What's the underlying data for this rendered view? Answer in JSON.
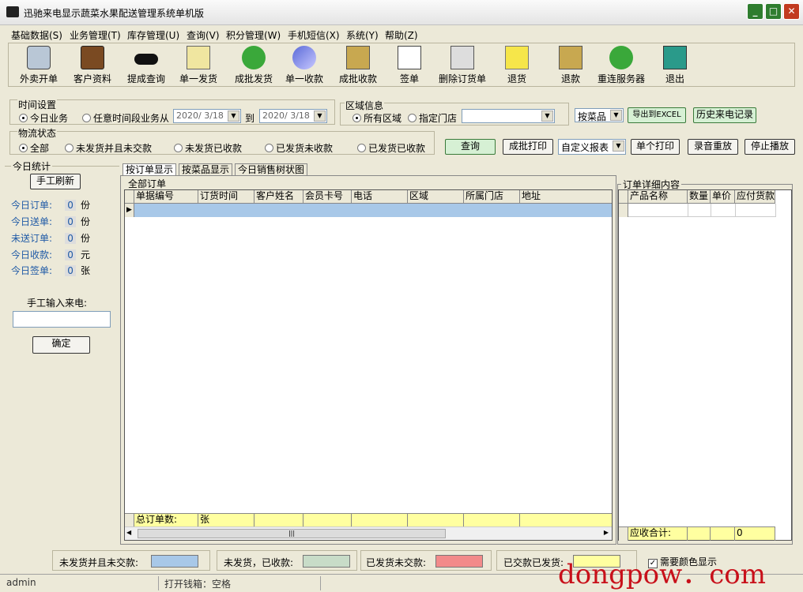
{
  "window": {
    "title": "迅驰来电显示蔬菜水果配送管理系统单机版"
  },
  "menu": [
    "基础数据(S)",
    "业务管理(T)",
    "库存管理(U)",
    "查询(V)",
    "积分管理(W)",
    "手机短信(X)",
    "系统(Y)",
    "帮助(Z)"
  ],
  "toolbar": [
    "外卖开单",
    "客户资料",
    "提成查询",
    "单一发货",
    "成批发货",
    "单一收款",
    "成批收款",
    "签单",
    "删除订货单",
    "退货",
    "退款",
    "重连服务器",
    "退出"
  ],
  "filters": {
    "time_group": "时间设置",
    "today_business": "今日业务",
    "any_period": "任意时间段业务从",
    "date_from": "2020/ 3/18",
    "to": "到",
    "date_to": "2020/ 3/18",
    "region_group": "区域信息",
    "all_regions": "所有区域",
    "specific_store": "指定门店",
    "store_value": "",
    "by_dish": "按菜品",
    "export_excel": "导出到EXCEL",
    "history_calls": "历史来电记录",
    "logistics_group": "物流状态",
    "all": "全部",
    "not_shipped_unpaid": "未发货并且未交款",
    "not_shipped_paid": "未发货已收款",
    "shipped_unpaid": "已发货未收款",
    "shipped_paid": "已发货已收款"
  },
  "actions": {
    "query": "查询",
    "batch_print": "成批打印",
    "custom_report": "自定义报表",
    "single_print": "单个打印",
    "replay": "录音重放",
    "stop_play": "停止播放"
  },
  "today_stats": {
    "title": "今日统计",
    "refresh": "手工刷新",
    "items": [
      {
        "label": "今日订单:",
        "value": "0",
        "unit": "份"
      },
      {
        "label": "今日送单:",
        "value": "0",
        "unit": "份"
      },
      {
        "label": "未送订单:",
        "value": "0",
        "unit": "份"
      },
      {
        "label": "今日收款:",
        "value": "0",
        "unit": "元"
      },
      {
        "label": "今日签单:",
        "value": "0",
        "unit": "张"
      }
    ],
    "manual_input_label": "手工输入来电:",
    "manual_input_value": "",
    "confirm": "确定"
  },
  "tabs": [
    "按订单显示",
    "按菜品显示",
    "今日销售树状图"
  ],
  "orders": {
    "title": "全部订单",
    "columns": [
      "单据编号",
      "订货时间",
      "客户姓名",
      "会员卡号",
      "电话",
      "区域",
      "所属门店",
      "地址"
    ],
    "footer_label": "总订单数:",
    "footer_unit": "张"
  },
  "details": {
    "title": "订单详细内容",
    "columns": [
      "产品名称",
      "数量",
      "单价",
      "应付货款"
    ],
    "footer_label": "应收合计:",
    "footer_value": "0"
  },
  "legend": {
    "a": "未发货并且未交款:",
    "b": "未发货，已收款:",
    "c": "已发货未交款:",
    "d": "已交款已发货:",
    "need_color": "需要颜色显示",
    "colors": {
      "a": "#a8c8e8",
      "b": "#c8dcc8",
      "c": "#f28a8a",
      "d": "#ffffa0"
    }
  },
  "status": {
    "user": "admin",
    "cashbox": "打开钱箱：空格"
  },
  "watermark": "dongpow．com"
}
